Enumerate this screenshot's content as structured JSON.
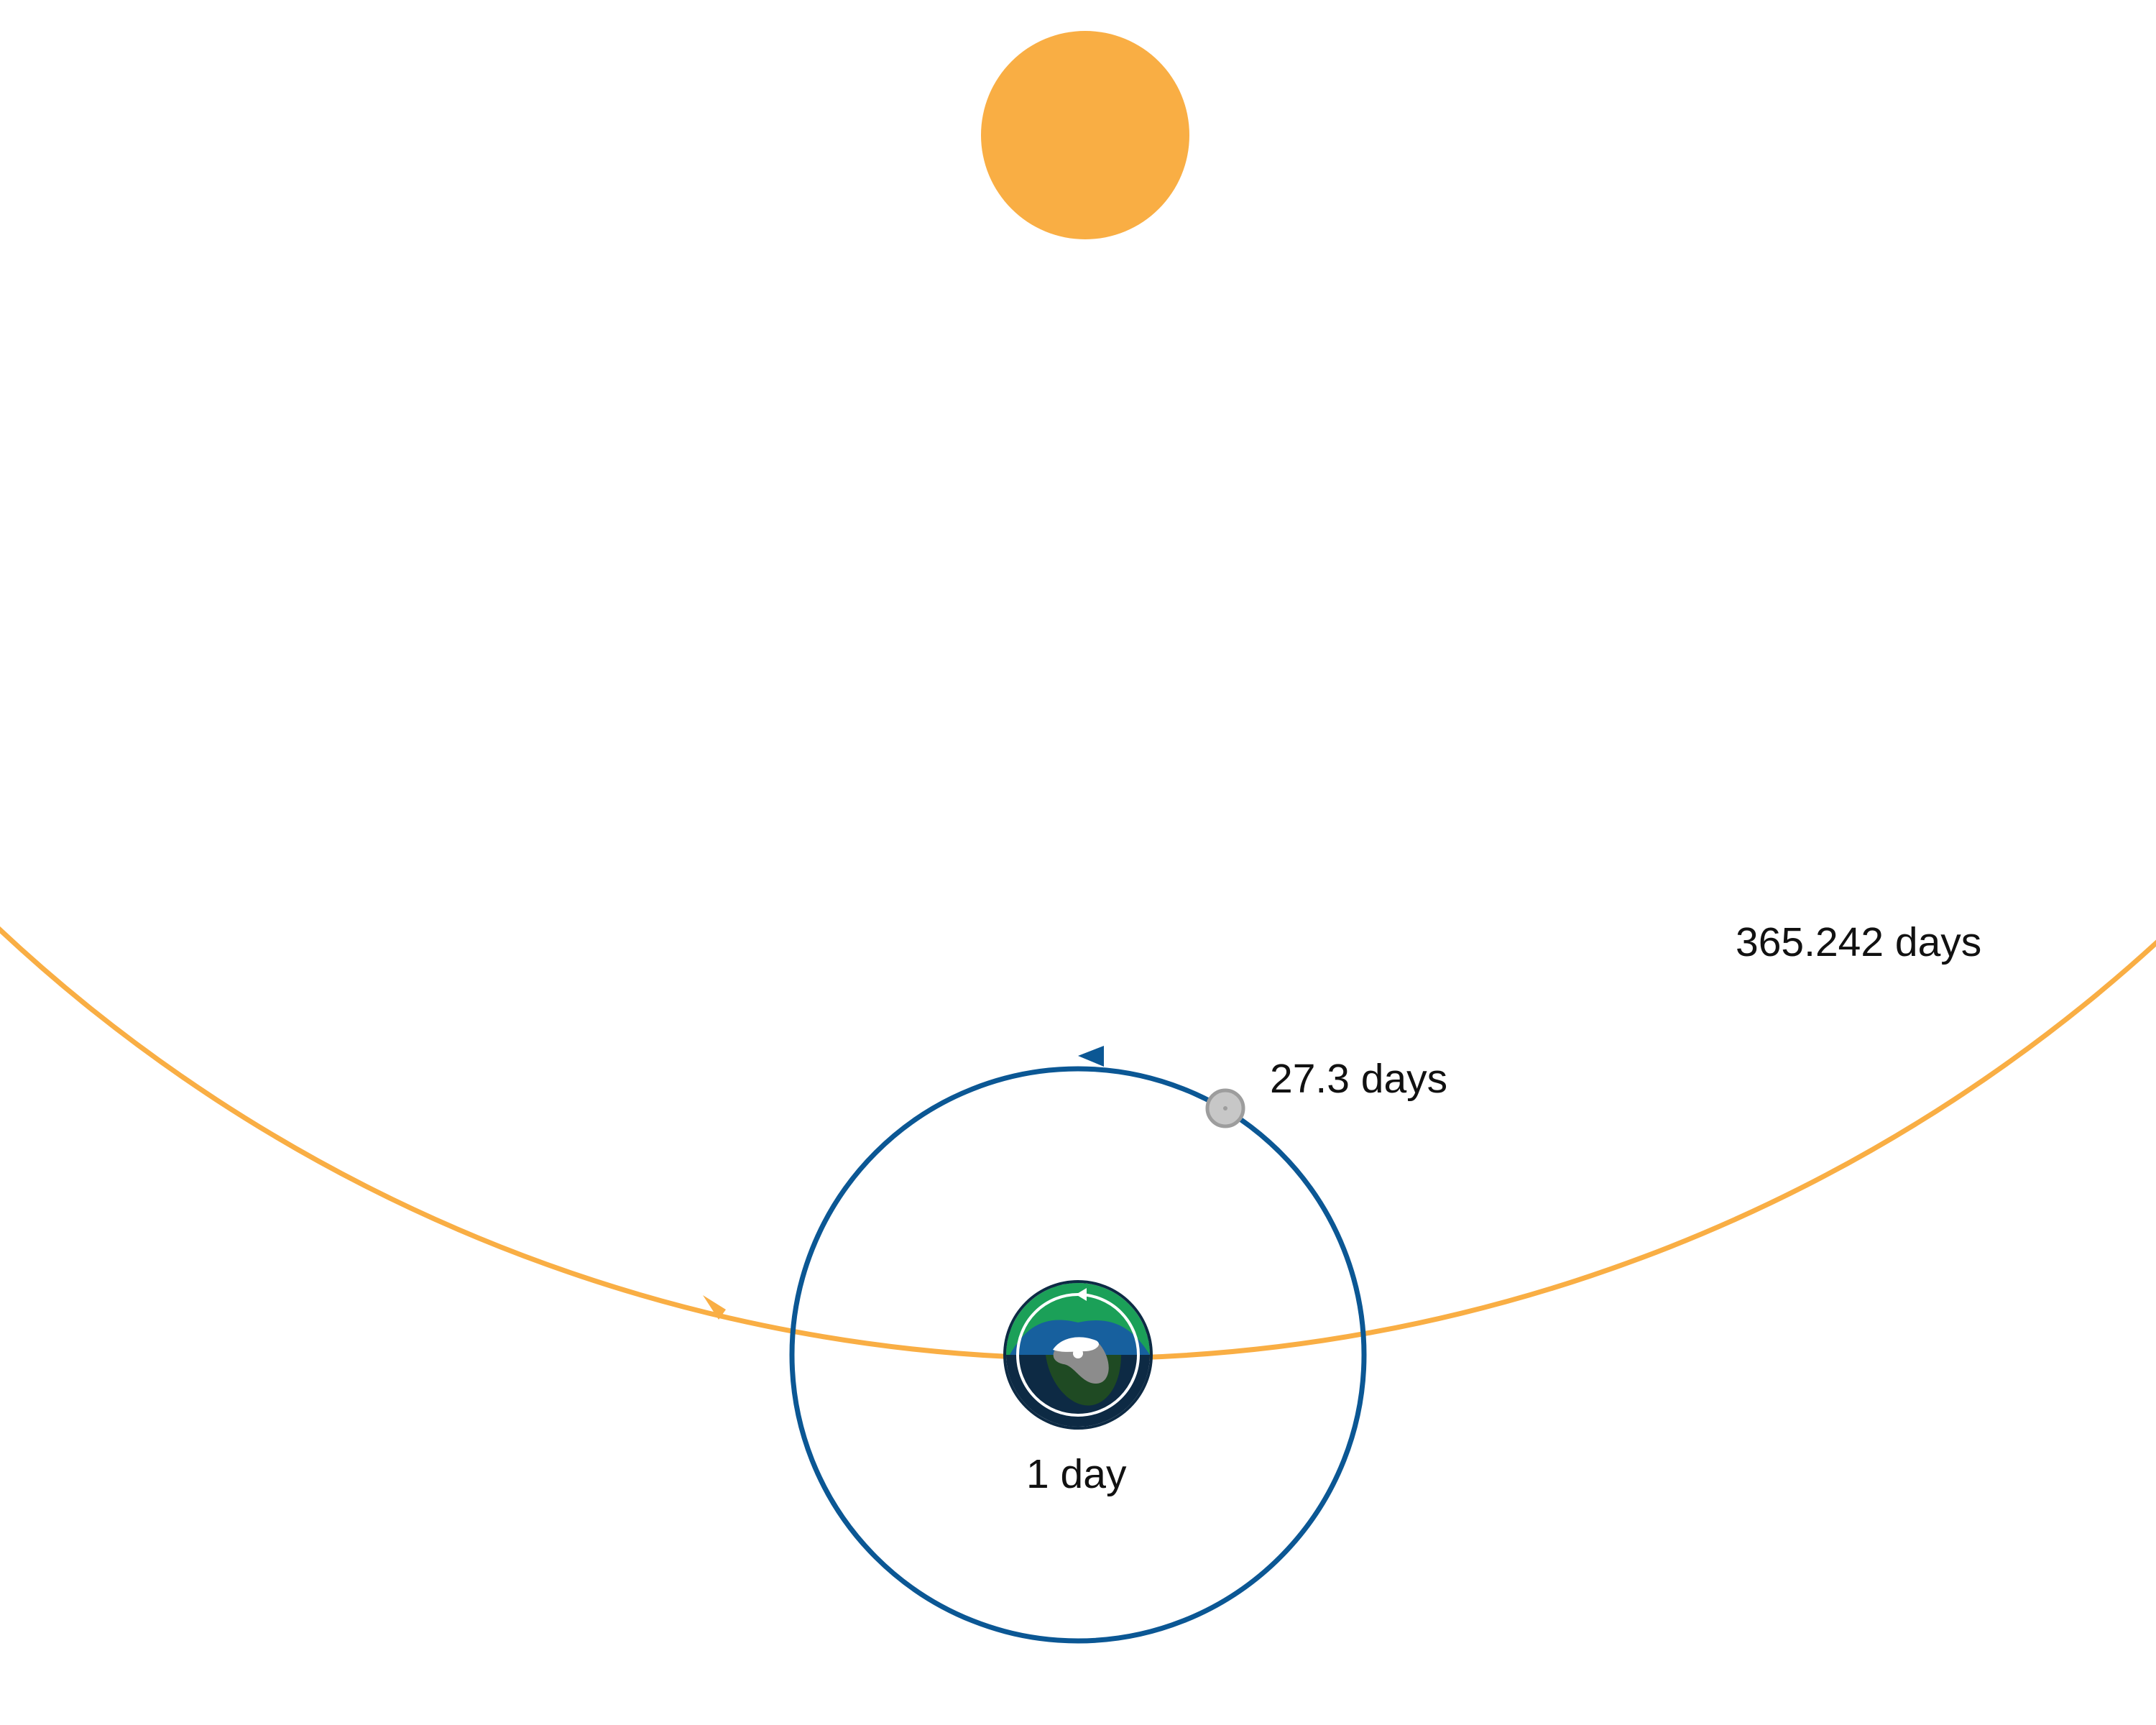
{
  "labels": {
    "year": "365.242 days",
    "month": "27.3 days",
    "day": "1 day"
  },
  "colors": {
    "sun": "#f9ae44",
    "earth_orbit": "#f9ae44",
    "moon_orbit": "#0b5794",
    "earth_ocean": "#17609e",
    "earth_land": "#1ba058",
    "earth_night_ocean": "#0d2a44",
    "earth_night_land": "#1f4a23",
    "earth_ice": "#ffffff",
    "earth_ice_shadow": "#8c8c8c",
    "moon": "#c7c7c7",
    "moon_edge": "#9d9d9d",
    "spin_arrow": "#ffffff"
  },
  "icons": {
    "sun": "sun-icon",
    "earth": "earth-icon",
    "moon": "moon-icon"
  }
}
